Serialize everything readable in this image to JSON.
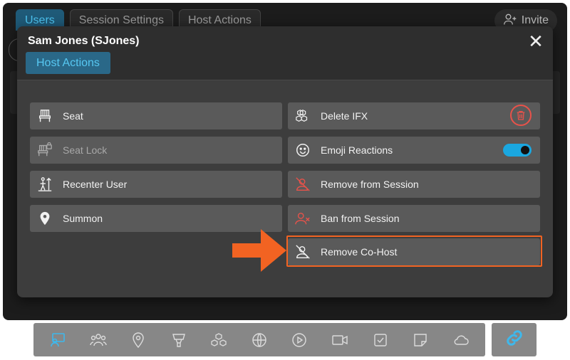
{
  "app": {
    "tabs": [
      {
        "label": "Users",
        "active": true
      },
      {
        "label": "Session Settings",
        "active": false
      },
      {
        "label": "Host Actions",
        "active": false
      }
    ],
    "invite_label": "Invite"
  },
  "modal": {
    "title": "Sam Jones (SJones)",
    "tab_label": "Host Actions",
    "left_actions": [
      {
        "label": "Seat",
        "icon": "seat-icon",
        "enabled": true
      },
      {
        "label": "Seat Lock",
        "icon": "seat-lock-icon",
        "enabled": false
      },
      {
        "label": "Recenter User",
        "icon": "recenter-icon",
        "enabled": true
      },
      {
        "label": "Summon",
        "icon": "location-pin-icon",
        "enabled": true
      }
    ],
    "right_actions": [
      {
        "label": "Delete IFX",
        "icon": "cubes-icon",
        "enabled": true
      },
      {
        "label": "Emoji Reactions",
        "icon": "smiley-icon",
        "enabled": true,
        "toggle_on": true
      },
      {
        "label": "Remove from Session",
        "icon": "remove-user-icon",
        "enabled": true
      },
      {
        "label": "Ban from Session",
        "icon": "ban-user-icon",
        "enabled": true
      },
      {
        "label": "Remove Co-Host",
        "icon": "remove-cohost-icon",
        "enabled": true,
        "highlighted": true
      }
    ]
  },
  "toolbar": {
    "tools": [
      "users-screen-icon",
      "group-icon",
      "location-icon",
      "trophy-icon",
      "cubes-icon",
      "globe-icon",
      "play-icon",
      "video-icon",
      "checkbox-icon",
      "note-icon",
      "cloud-icon"
    ],
    "link_icon": "link-icon"
  },
  "colors": {
    "accent": "#1aa7e0",
    "danger": "#e8524a",
    "highlight": "#f26322"
  }
}
